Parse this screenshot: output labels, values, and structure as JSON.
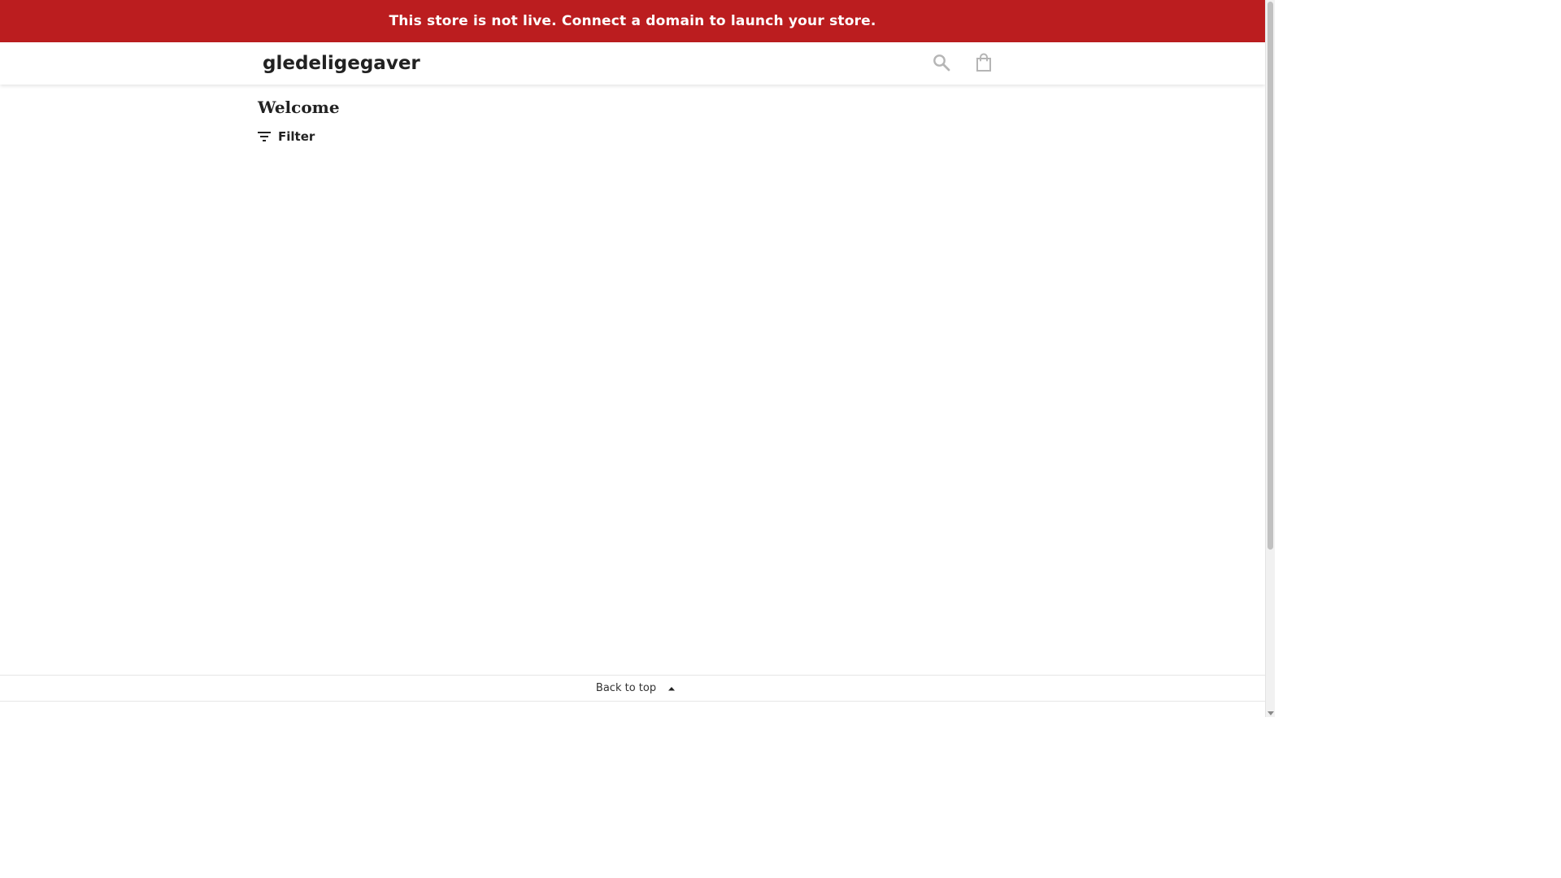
{
  "banner": {
    "message": "This store is not live. Connect a domain to launch your store.",
    "background_color": "#bb1d1f"
  },
  "header": {
    "store_name": "gledeligegaver",
    "search_icon": "search-icon",
    "cart_icon": "shopping-bag-icon"
  },
  "main": {
    "title": "Welcome",
    "filter_label": "Filter",
    "filter_icon": "filter-icon"
  },
  "footer": {
    "back_to_top_label": "Back to top",
    "back_to_top_icon": "caret-up-icon"
  }
}
